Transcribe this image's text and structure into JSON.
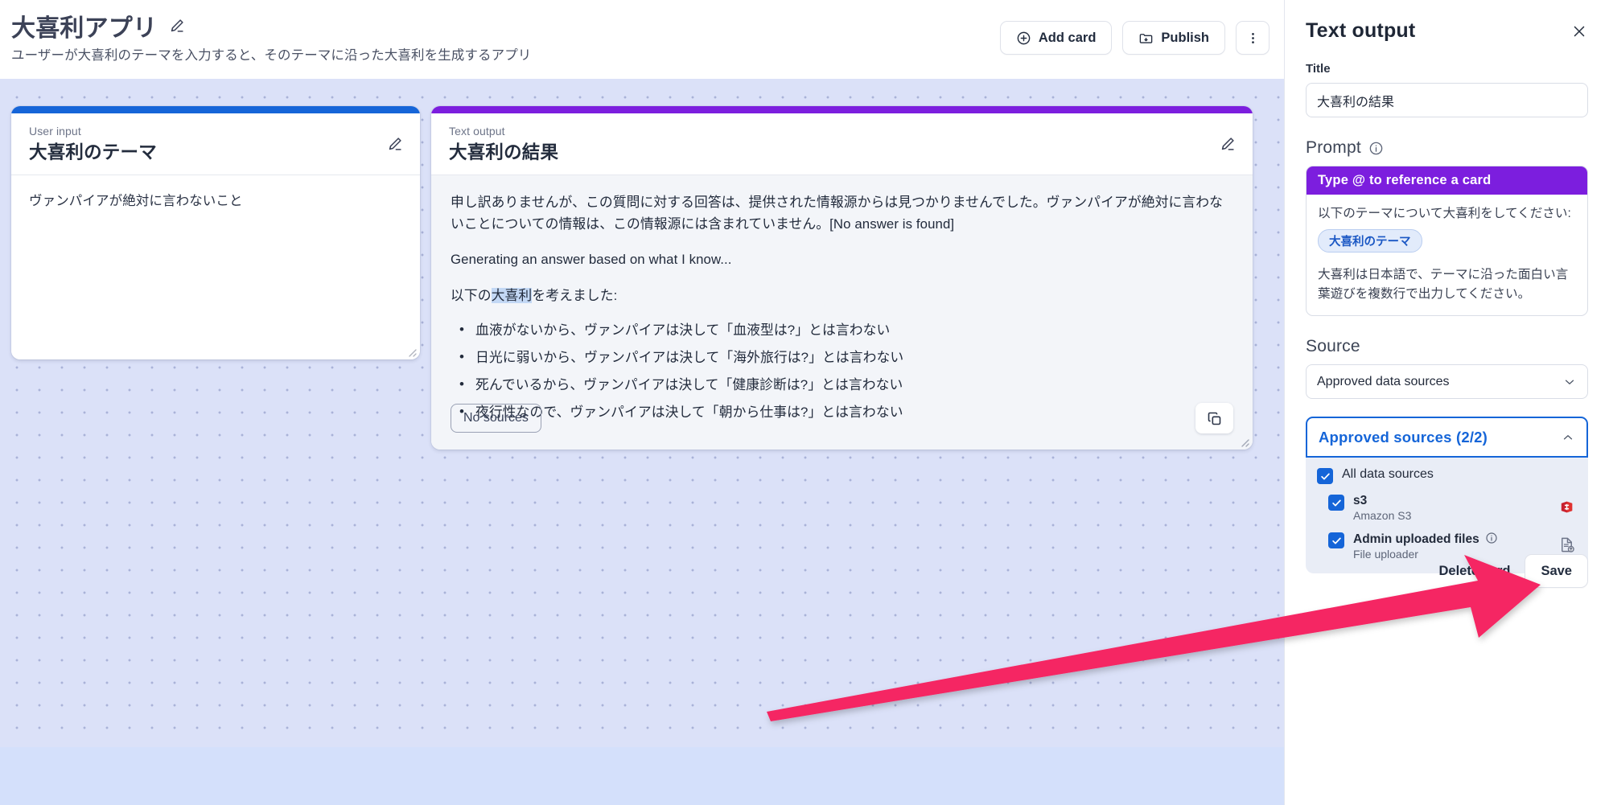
{
  "header": {
    "app_title": "大喜利アプリ",
    "app_subtitle": "ユーザーが大喜利のテーマを入力すると、そのテーマに沿った大喜利を生成するアプリ",
    "edit_title_icon": "pencil-icon",
    "add_card_label": "Add card",
    "publish_label": "Publish",
    "more_menu_icon": "three-dots-vertical-icon"
  },
  "cards": {
    "user_input": {
      "kicker": "User input",
      "title": "大喜利のテーマ",
      "accent_color": "#1665d8",
      "value": "ヴァンパイアが絶対に言わないこと",
      "edit_icon": "pencil-icon"
    },
    "text_output": {
      "kicker": "Text output",
      "title": "大喜利の結果",
      "accent_color": "#7c1ede",
      "edit_icon": "pencil-icon",
      "paragraphs": [
        "申し訳ありませんが、この質問に対する回答は、提供された情報源からは見つかりませんでした。ヴァンパイアが絶対に言わないことについての情報は、この情報源には含まれていません。[No answer is found]",
        "Generating an answer based on what I know..."
      ],
      "intro_before": "以下の",
      "intro_highlight": "大喜利",
      "intro_after": "を考えました:",
      "bullets": [
        "血液がないから、ヴァンパイアは決して「血液型は?」とは言わない",
        "日光に弱いから、ヴァンパイアは決して「海外旅行は?」とは言わない",
        "死んでいるから、ヴァンパイアは決して「健康診断は?」とは言わない",
        "夜行性なので、ヴァンパイアは決して「朝から仕事は?」とは言わない"
      ],
      "sources_button_label": "No sources",
      "copy_icon": "copy-icon"
    }
  },
  "panel": {
    "title": "Text output",
    "close_icon": "close-icon",
    "title_field": {
      "label": "Title",
      "value": "大喜利の結果"
    },
    "prompt": {
      "label": "Prompt",
      "info_icon": "info-circle-icon",
      "hint_bar": "Type @ to reference a card",
      "line1": "以下のテーマについて大喜利をしてください:",
      "card_reference": "大喜利のテーマ",
      "line2": "大喜利は日本語で、テーマに沿った面白い言葉遊びを複数行で出力してください。"
    },
    "source": {
      "label": "Source",
      "selected": "Approved data sources",
      "chevron_icon": "chevron-down-icon"
    },
    "approved": {
      "header": "Approved sources (2/2)",
      "chevron_icon": "chevron-up-icon",
      "all_label": "All data sources",
      "items": [
        {
          "name": "s3",
          "subtitle": "Amazon S3",
          "icon": "amazon-s3-icon",
          "has_info": false
        },
        {
          "name": "Admin uploaded files",
          "subtitle": "File uploader",
          "icon": "file-upload-icon",
          "has_info": true
        }
      ]
    },
    "delete_label": "Delete card",
    "save_label": "Save"
  },
  "annotation": {
    "arrow_color": "#f52563",
    "arrow_name": "pink-pointer-arrow"
  }
}
